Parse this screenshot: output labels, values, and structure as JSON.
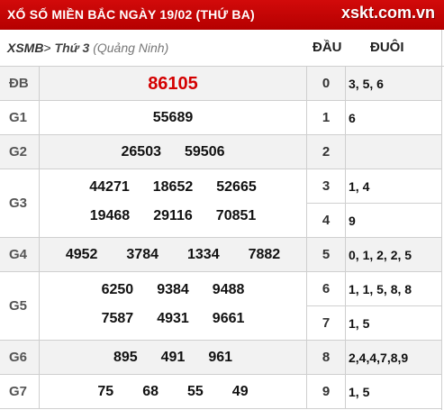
{
  "header": {
    "title": "XỔ SỐ MIỀN BẮC NGÀY 19/02 (THỨ BA)",
    "logo": "xskt.com.vn"
  },
  "subheader": {
    "breadcrumb_code": "XSMB",
    "breadcrumb_sep": ">",
    "breadcrumb_day": "Thứ 3",
    "breadcrumb_province": "(Quảng Ninh)",
    "col_dau": "ĐẦU",
    "col_duoi": "ĐUÔI"
  },
  "prizes": [
    {
      "label": "ĐB",
      "lines": [
        [
          "86105"
        ]
      ]
    },
    {
      "label": "G1",
      "lines": [
        [
          "55689"
        ]
      ]
    },
    {
      "label": "G2",
      "lines": [
        [
          "26503",
          "59506"
        ]
      ]
    },
    {
      "label": "G3",
      "lines": [
        [
          "44271",
          "18652",
          "52665"
        ],
        [
          "19468",
          "29116",
          "70851"
        ]
      ]
    },
    {
      "label": "G4",
      "lines": [
        [
          "4952",
          "3784",
          "1334",
          "7882"
        ]
      ]
    },
    {
      "label": "G5",
      "lines": [
        [
          "6250",
          "9384",
          "9488"
        ],
        [
          "7587",
          "4931",
          "9661"
        ]
      ]
    },
    {
      "label": "G6",
      "lines": [
        [
          "895",
          "491",
          "961"
        ]
      ]
    },
    {
      "label": "G7",
      "lines": [
        [
          "75",
          "68",
          "55",
          "49"
        ]
      ]
    }
  ],
  "loto": [
    {
      "dau": "0",
      "duoi": "3, 5, 6"
    },
    {
      "dau": "1",
      "duoi": "6"
    },
    {
      "dau": "2",
      "duoi": ""
    },
    {
      "dau": "3",
      "duoi": "1, 4"
    },
    {
      "dau": "4",
      "duoi": "9"
    },
    {
      "dau": "5",
      "duoi": "0, 1, 2, 2, 5"
    },
    {
      "dau": "6",
      "duoi": "1, 1, 5, 8, 8"
    },
    {
      "dau": "7",
      "duoi": "1, 5"
    },
    {
      "dau": "8",
      "duoi": "2,4,4,7,8,9"
    },
    {
      "dau": "9",
      "duoi": "1, 5"
    }
  ],
  "colors": {
    "header_bg": "#c40000",
    "special_prize": "#d40000",
    "alt_row": "#f2f2f2"
  }
}
